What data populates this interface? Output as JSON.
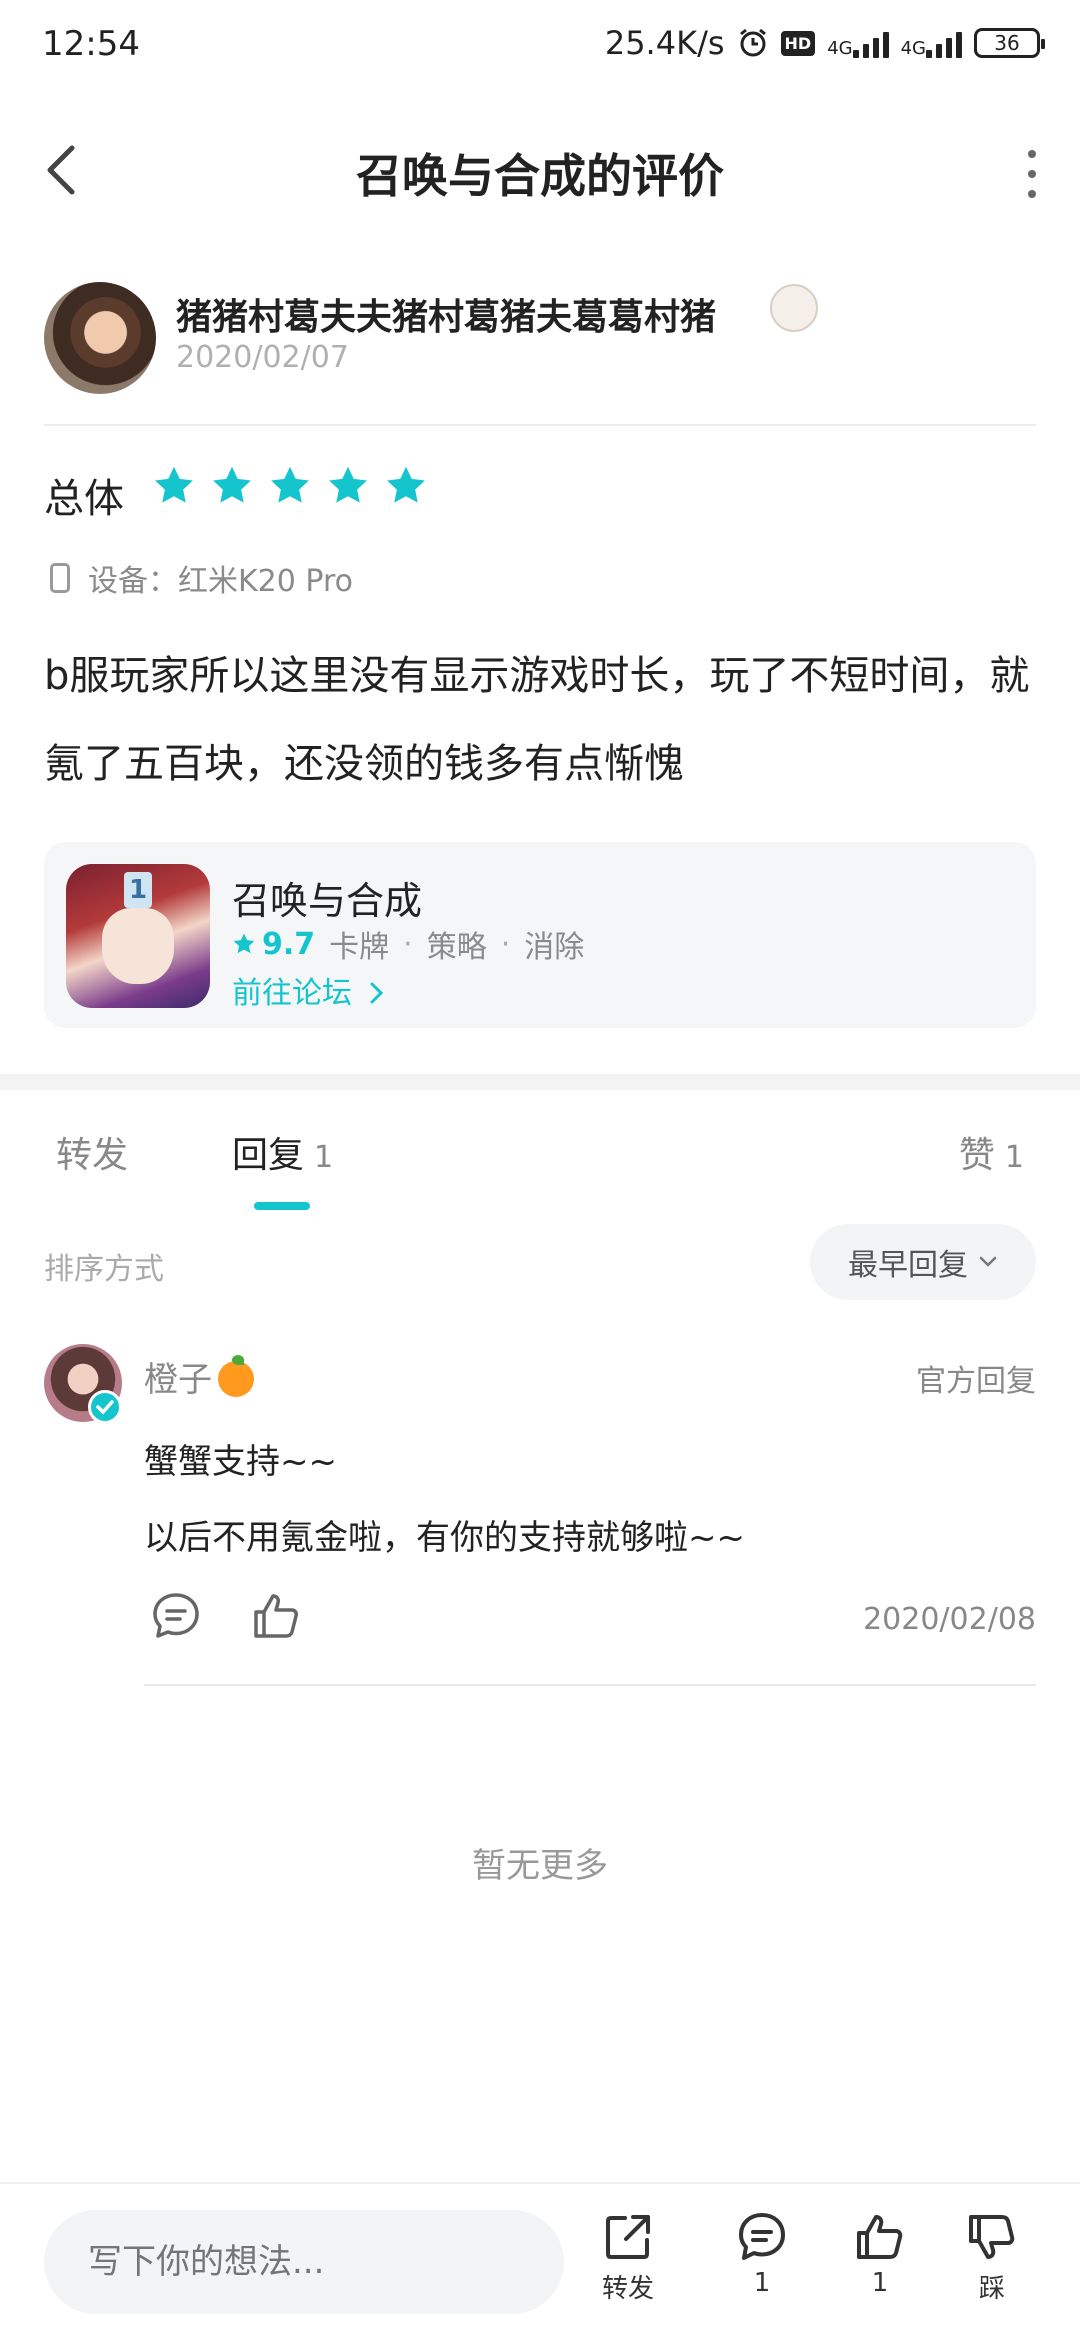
{
  "status_bar": {
    "time": "12:54",
    "net_speed": "25.4K/s",
    "hd": "HD",
    "net1": "4G",
    "net2": "4G",
    "battery": "36"
  },
  "header": {
    "title": "召唤与合成的评价"
  },
  "review": {
    "author": "猪猪村葛夫夫猪村葛猪夫葛葛村猪",
    "date": "2020/02/07",
    "overall_label": "总体",
    "rating": 5,
    "device": "设备：红米K20 Pro",
    "text": "b服玩家所以这里没有显示游戏时长，玩了不短时间，就氪了五百块，还没领的钱多有点惭愧"
  },
  "app_card": {
    "name": "召唤与合成",
    "score": "9.7",
    "tags": [
      "卡牌",
      "策略",
      "消除"
    ],
    "forum_link": "前往论坛",
    "icon_number": "1"
  },
  "tabs": {
    "forward": "转发",
    "reply": "回复",
    "reply_count": "1",
    "like": "赞",
    "like_count": "1"
  },
  "sort": {
    "label": "排序方式",
    "selected": "最早回复"
  },
  "reply": {
    "name": "橙子",
    "tag": "官方回复",
    "line1": "蟹蟹支持~~",
    "line2": "以后不用氪金啦，有你的支持就够啦~~",
    "date": "2020/02/08"
  },
  "no_more": "暂无更多",
  "bottom_bar": {
    "placeholder": "写下你的想法...",
    "forward_label": "转发",
    "reply_count": "1",
    "like_count": "1",
    "dislike_label": "踩"
  },
  "colors": {
    "accent": "#15c5ce"
  }
}
